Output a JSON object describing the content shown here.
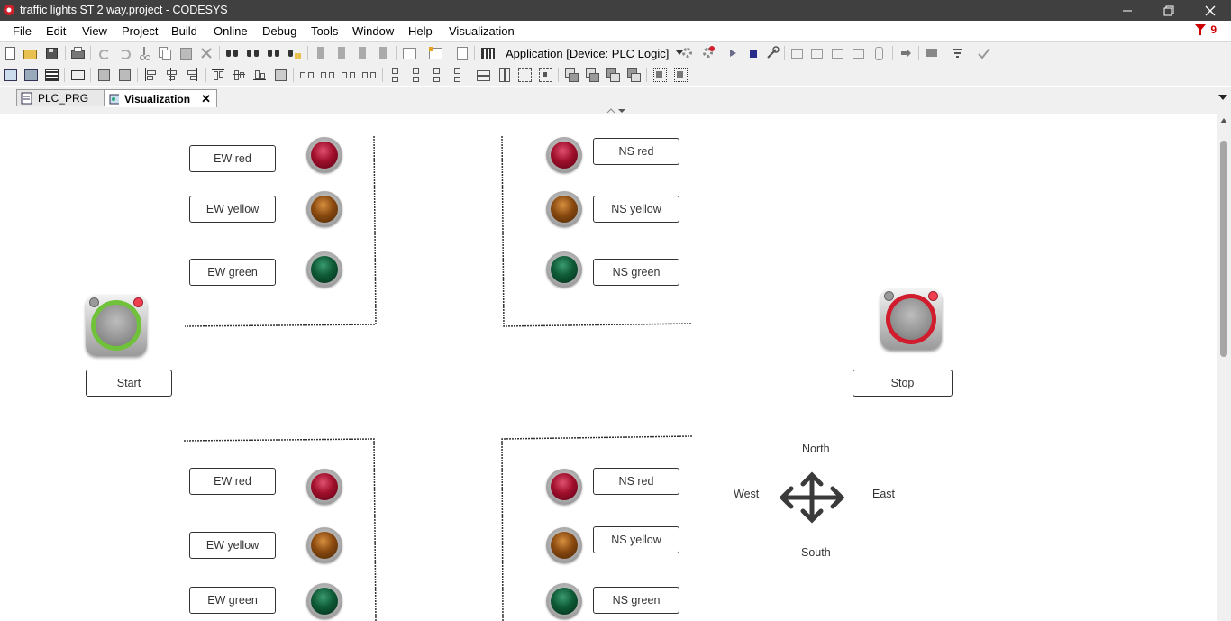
{
  "window": {
    "title": "traffic lights ST 2 way.project - CODESYS"
  },
  "menu": [
    "File",
    "Edit",
    "View",
    "Project",
    "Build",
    "Online",
    "Debug",
    "Tools",
    "Window",
    "Help",
    "Visualization"
  ],
  "error_count": "9",
  "toolbar": {
    "application_selector": "Application [Device: PLC Logic]"
  },
  "tabs": [
    {
      "label": "PLC_PRG",
      "active": false
    },
    {
      "label": "Visualization",
      "active": true
    }
  ],
  "visualization": {
    "top_left": {
      "red": "EW red",
      "yellow": "EW yellow",
      "green": "EW green"
    },
    "top_right": {
      "red": "NS red",
      "yellow": "NS yellow",
      "green": "NS green"
    },
    "bottom_left": {
      "red": "EW red",
      "yellow": "EW yellow",
      "green": "EW green"
    },
    "bottom_right": {
      "red": "NS red",
      "yellow": "NS yellow",
      "green": "NS green"
    },
    "start_label": "Start",
    "stop_label": "Stop",
    "compass": {
      "north": "North",
      "south": "South",
      "east": "East",
      "west": "West"
    }
  },
  "colors": {
    "titlebar": "#404040",
    "error": "#cc0000",
    "start_ring": "#6fc23a",
    "stop_ring": "#d01c2c"
  }
}
